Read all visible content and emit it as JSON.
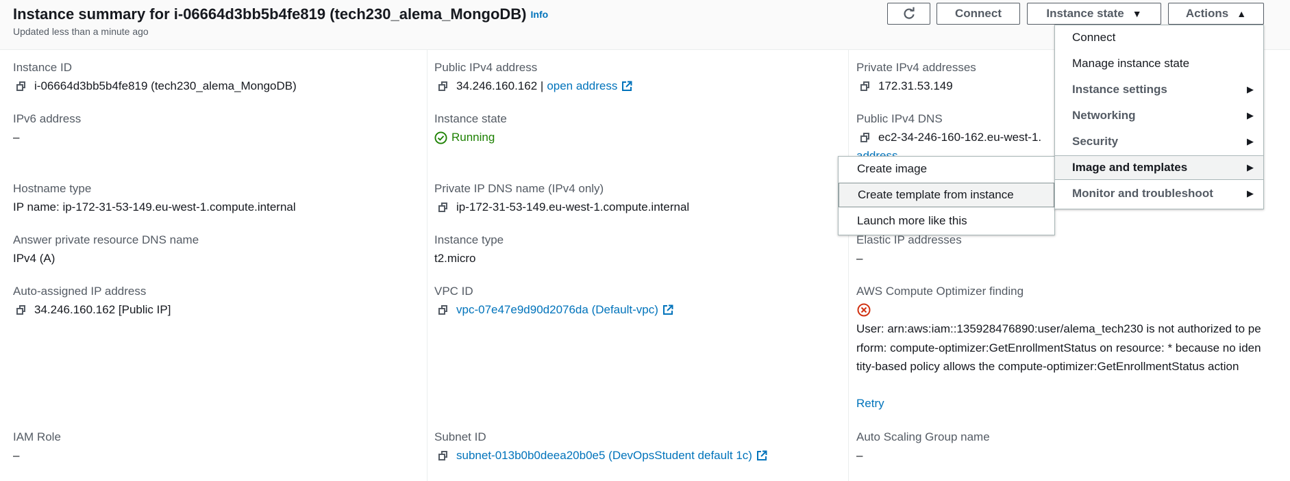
{
  "header": {
    "title": "Instance summary for i-06664d3bb5b4fe819 (tech230_alema_MongoDB)",
    "info_label": "Info",
    "subtitle": "Updated less than a minute ago",
    "refresh_icon": "refresh-icon",
    "connect_label": "Connect",
    "instance_state_label": "Instance state",
    "actions_label": "Actions"
  },
  "fields": {
    "instance_id": {
      "label": "Instance ID",
      "value": "i-06664d3bb5b4fe819 (tech230_alema_MongoDB)"
    },
    "public_ipv4": {
      "label": "Public IPv4 address",
      "value": "34.246.160.162 |",
      "link": "open address"
    },
    "private_ipv4": {
      "label": "Private IPv4 addresses",
      "value": "172.31.53.149"
    },
    "ipv6": {
      "label": "IPv6 address",
      "value": "–"
    },
    "instance_state": {
      "label": "Instance state",
      "value": "Running"
    },
    "public_dns": {
      "label": "Public IPv4 DNS",
      "value": "ec2-34-246-160-162.eu-west-1.",
      "link_fragment": "address"
    },
    "hostname_type": {
      "label": "Hostname type",
      "value": "IP name: ip-172-31-53-149.eu-west-1.compute.internal"
    },
    "private_dns": {
      "label": "Private IP DNS name (IPv4 only)",
      "value": "ip-172-31-53-149.eu-west-1.compute.internal"
    },
    "answer_dns": {
      "label": "Answer private resource DNS name",
      "value": "IPv4 (A)"
    },
    "instance_type": {
      "label": "Instance type",
      "value": "t2.micro"
    },
    "elastic_ip": {
      "label": "Elastic IP addresses",
      "value": "–"
    },
    "auto_ip": {
      "label": "Auto-assigned IP address",
      "value": "34.246.160.162 [Public IP]"
    },
    "vpc_id": {
      "label": "VPC ID",
      "value": "vpc-07e47e9d90d2076da (Default-vpc)"
    },
    "optimizer": {
      "label": "AWS Compute Optimizer finding",
      "error": "User: arn:aws:iam::135928476890:user/alema_tech230 is not authorized to perform: compute-optimizer:GetEnrollmentStatus on resource: * because no identity-based policy allows the compute-optimizer:GetEnrollmentStatus action",
      "retry": "Retry"
    },
    "iam_role": {
      "label": "IAM Role",
      "value": "–"
    },
    "subnet_id": {
      "label": "Subnet ID",
      "value": "subnet-013b0b0deea20b0e5 (DevOpsStudent default 1c)"
    },
    "asg_name": {
      "label": "Auto Scaling Group name",
      "value": "–"
    }
  },
  "actions_menu": {
    "items": [
      "Connect",
      "Manage instance state",
      "Instance settings",
      "Networking",
      "Security",
      "Image and templates",
      "Monitor and troubleshoot"
    ],
    "highlighted": "Image and templates"
  },
  "submenu": {
    "items": [
      "Create image",
      "Create template from instance",
      "Launch more like this"
    ],
    "highlighted": "Create template from instance"
  },
  "colors": {
    "link": "#0073bb",
    "running": "#1d8102",
    "error": "#d13212",
    "label": "#545b64",
    "text": "#16191f"
  }
}
